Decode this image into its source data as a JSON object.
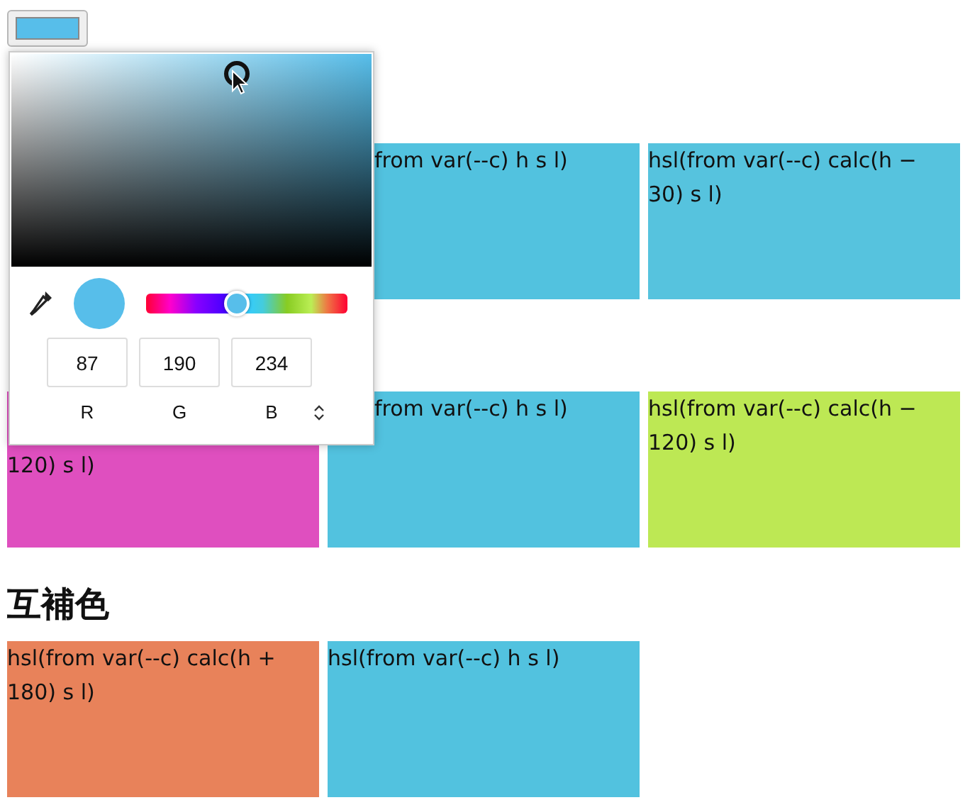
{
  "color_input": {
    "color": "#57beea"
  },
  "picker": {
    "color": "#57beea",
    "hue": {
      "level": 0.45
    },
    "channels": [
      {
        "label": "R",
        "value": "87"
      },
      {
        "label": "G",
        "value": "190"
      },
      {
        "label": "B",
        "value": "234"
      }
    ]
  },
  "sections": [
    {
      "boxes": [
        {
          "kind": "covered"
        },
        {
          "kind": "covered_left",
          "color": "#52c2df",
          "text": "from var(--c) h s l)"
        },
        {
          "kind": "box",
          "color": "#56c3de",
          "text": "hsl(from var(--c) calc(h − 30) s l)"
        }
      ]
    },
    {
      "boxes": [
        {
          "kind": "covered_top",
          "color": "#df4fbf",
          "text": "120) s l)"
        },
        {
          "kind": "covered_left",
          "color": "#52c2df",
          "text": "from var(--c) h s l)"
        },
        {
          "kind": "box",
          "color": "#bde854",
          "text": "hsl(from var(--c) calc(h − 120) s l)"
        }
      ]
    },
    {
      "heading": "互補色",
      "boxes": [
        {
          "kind": "box",
          "color": "#e8825a",
          "text": "hsl(from var(--c) calc(h + 180) s l)"
        },
        {
          "kind": "box",
          "color": "#52c2df",
          "text": "hsl(from var(--c) h s l)"
        }
      ]
    }
  ]
}
